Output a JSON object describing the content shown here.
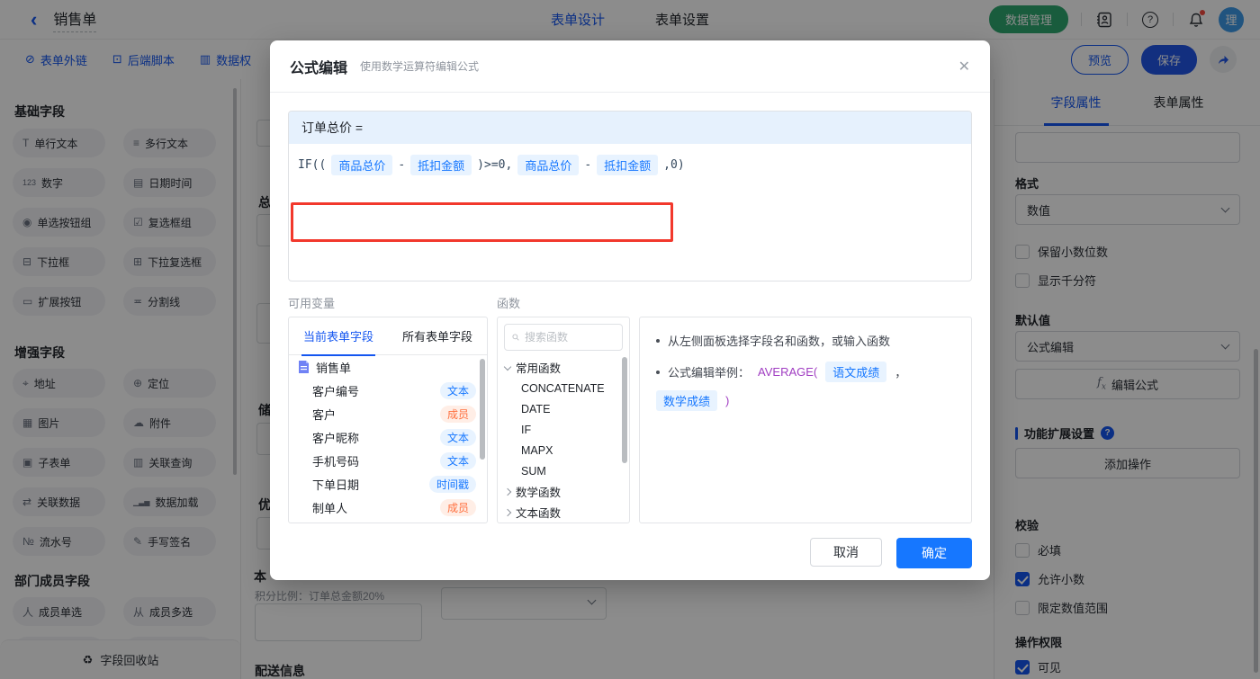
{
  "topbar": {
    "title": "销售单",
    "tab_design": "表单设计",
    "tab_settings": "表单设置",
    "data_manage": "数据管理",
    "avatar": "理"
  },
  "toolbar": {
    "external": "表单外链",
    "script": "后端脚本",
    "permission": "数据权",
    "preview": "预览",
    "save": "保存"
  },
  "sidebar": {
    "section1": "基础字段",
    "s1": [
      "单行文本",
      "多行文本",
      "数字",
      "日期时间",
      "单选按钮组",
      "复选框组",
      "下拉框",
      "下拉复选框",
      "扩展按钮",
      "分割线"
    ],
    "section2": "增强字段",
    "s2": [
      "地址",
      "定位",
      "图片",
      "附件",
      "子表单",
      "关联查询",
      "关联数据",
      "数据加载",
      "流水号",
      "手写签名"
    ],
    "section3": "部门成员字段",
    "s3": [
      "成员单选",
      "成员多选"
    ],
    "recycle": "字段回收站"
  },
  "canvas": {
    "label1": "总",
    "label2": "储",
    "label3": "优",
    "points_label": "本",
    "points_hint": "积分比例：订单总金额20%",
    "delivery": "配送信息"
  },
  "modal": {
    "title": "公式编辑",
    "subtitle": "使用数学运算符编辑公式",
    "close": "✕",
    "target": "订单总价 =",
    "seg": [
      "IF((",
      "商品总价",
      "-",
      "抵扣金额",
      ")>=0,",
      "商品总价",
      "-",
      "抵扣金额",
      ",0)"
    ],
    "vars": {
      "label": "可用变量",
      "tab_current": "当前表单字段",
      "tab_all": "所有表单字段",
      "form": "销售单",
      "rows": [
        {
          "name": "客户编号",
          "tag": "文本"
        },
        {
          "name": "客户",
          "tag": "成员"
        },
        {
          "name": "客户昵称",
          "tag": "文本"
        },
        {
          "name": "手机号码",
          "tag": "文本"
        },
        {
          "name": "下单日期",
          "tag": "时间戳"
        },
        {
          "name": "制单人",
          "tag": "成员"
        }
      ]
    },
    "fns": {
      "label": "函数",
      "search_placeholder": "搜索函数",
      "group1": "常用函数",
      "items": [
        "CONCATENATE",
        "DATE",
        "IF",
        "MAPX",
        "SUM"
      ],
      "group2": "数学函数",
      "group3": "文本函数"
    },
    "help": {
      "line1": "从左侧面板选择字段名和函数，或输入函数",
      "example_label": "公式编辑举例：",
      "fn_open": "AVERAGE(",
      "arg1": "语文成绩",
      "comma": "，",
      "arg2": "数学成绩",
      "fn_close": ")"
    },
    "cancel": "取消",
    "confirm": "确定"
  },
  "panel": {
    "tab_field": "字段属性",
    "tab_form": "表单属性",
    "format_label": "格式",
    "format_value": "数值",
    "opt_decimal": "保留小数位数",
    "opt_thousand": "显示千分符",
    "default_label": "默认值",
    "default_value": "公式编辑",
    "fx": "fx",
    "edit_formula": "编辑公式",
    "ext_section": "功能扩展设置",
    "add_action": "添加操作",
    "validate": "校验",
    "required": "必填",
    "allow_decimal": "允许小数",
    "limit_range": "限定数值范围",
    "perm": "操作权限",
    "visible": "可见",
    "checked": {
      "required": false,
      "allow_decimal": true,
      "limit_range": false,
      "visible": true,
      "decimal_digits": false,
      "thousand_sep": false
    }
  },
  "colors": {
    "accent": "#1456f0",
    "confirm_blue": "#1677ff",
    "green": "#2ea86f",
    "annotation_red": "#f2382c",
    "chip_bg": "#e8f3ff",
    "chip_text": "#1677ff",
    "member_bg": "#ffeee6",
    "member_text": "#ff6f3d"
  }
}
